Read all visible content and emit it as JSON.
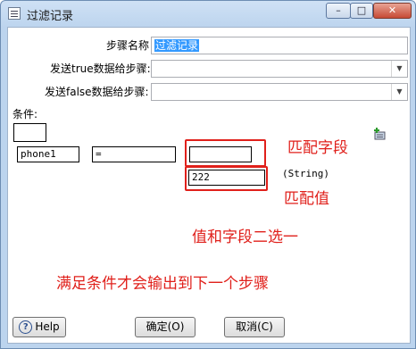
{
  "window": {
    "title": "过滤记录"
  },
  "titlebar": {
    "min": "–",
    "max": "□",
    "close": "✕"
  },
  "form": {
    "step_name_label": "步骤名称",
    "step_name_value": "过滤记录",
    "send_true_label": "发送true数据给步骤:",
    "send_true_value": "",
    "send_false_label": "发送false数据给步骤:",
    "send_false_value": ""
  },
  "condition": {
    "label": "条件:",
    "field_left": "phone1",
    "operator": "=",
    "field_right": "",
    "value": "222",
    "value_type": "(String)"
  },
  "annotations": {
    "match_field": "匹配字段",
    "match_value": "匹配值",
    "choose_one": "值和字段二选一",
    "output_note": "满足条件才会输出到下一个步骤"
  },
  "buttons": {
    "help": "Help",
    "ok": "确定(O)",
    "cancel": "取消(C)"
  }
}
